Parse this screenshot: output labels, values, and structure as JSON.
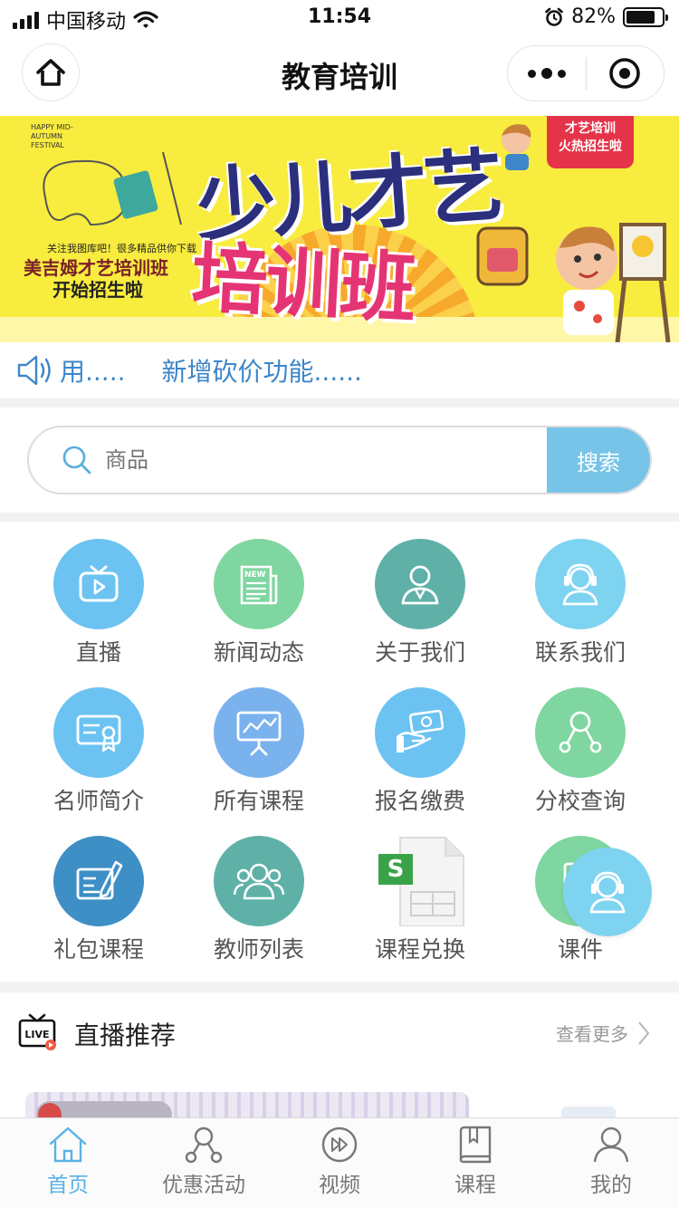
{
  "status_bar": {
    "carrier": "中国移动",
    "time": "11:54",
    "battery": "82%",
    "battery_level": 0.82
  },
  "nav": {
    "title": "教育培训"
  },
  "banner": {
    "line1": "少儿才艺",
    "line2": "培训班",
    "small_note": "关注我图库吧！很多精品供你下载",
    "small_title": "美吉姆才艺培训班",
    "small_sub": "开始招生啦",
    "tag_line1": "才艺培训",
    "tag_line2": "火热招生啦",
    "festival": "HAPPY MID-AUTUMN FESTIVAL"
  },
  "notice": {
    "item1": "用.....",
    "item2": "新增砍价功能......"
  },
  "search": {
    "placeholder": "商品",
    "button": "搜索"
  },
  "grid": [
    {
      "label": "直播",
      "icon": "tv-play-icon",
      "color": "#6cc3f2"
    },
    {
      "label": "新闻动态",
      "icon": "news-icon",
      "color": "#7fd6a0"
    },
    {
      "label": "关于我们",
      "icon": "person-icon",
      "color": "#5fb1a8"
    },
    {
      "label": "联系我们",
      "icon": "customer-service-icon",
      "color": "#7ed3f0"
    },
    {
      "label": "名师简介",
      "icon": "certificate-icon",
      "color": "#6cc3f2"
    },
    {
      "label": "所有课程",
      "icon": "presentation-chart-icon",
      "color": "#7ab2ee"
    },
    {
      "label": "报名缴费",
      "icon": "payment-icon",
      "color": "#6cc3f2"
    },
    {
      "label": "分校查询",
      "icon": "branch-network-icon",
      "color": "#7fd6a0"
    },
    {
      "label": "礼包课程",
      "icon": "edit-card-icon",
      "color": "#3d8fc5"
    },
    {
      "label": "教师列表",
      "icon": "group-icon",
      "color": "#5fb1a8"
    },
    {
      "label": "课程兑换",
      "icon": "spreadsheet-file-icon",
      "color": ""
    },
    {
      "label": "课件",
      "icon": "courseware-icon",
      "color": "#7fd6a0"
    }
  ],
  "live": {
    "title": "直播推荐",
    "more": "查看更多",
    "icon_text": "LIVE"
  },
  "tabs": [
    {
      "label": "首页",
      "icon": "home-icon"
    },
    {
      "label": "优惠活动",
      "icon": "discount-network-icon"
    },
    {
      "label": "视频",
      "icon": "video-forward-icon"
    },
    {
      "label": "课程",
      "icon": "book-icon"
    },
    {
      "label": "我的",
      "icon": "user-icon"
    }
  ],
  "colors": {
    "accent": "#59b2e5",
    "search_button": "#77c4e8",
    "notice_text": "#3c86c9"
  }
}
